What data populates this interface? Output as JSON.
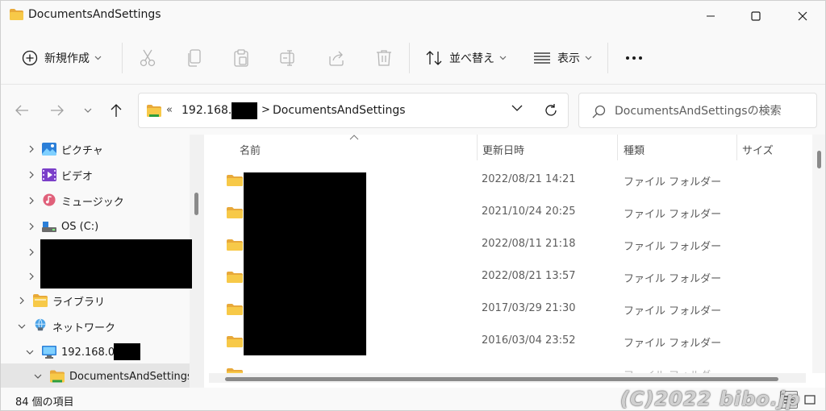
{
  "window": {
    "title": "DocumentsAndSettings",
    "colors": {
      "folder": "#f7c948",
      "folder_dark": "#e8a93a",
      "accent": "#0067c0"
    }
  },
  "commandbar": {
    "new_label": "新規作成",
    "sort_label": "並べ替え",
    "view_label": "表示",
    "more_label": "•••"
  },
  "address": {
    "overflow": "«",
    "ip_prefix": "192.168.0",
    "arrow": ">",
    "current_folder": "DocumentsAndSettings"
  },
  "search": {
    "placeholder": "DocumentsAndSettingsの検索"
  },
  "nav": {
    "items": [
      {
        "label": "ピクチャ",
        "icon": "pictures-icon"
      },
      {
        "label": "ビデオ",
        "icon": "videos-icon"
      },
      {
        "label": "ミュージック",
        "icon": "music-icon"
      },
      {
        "label": "OS (C:)",
        "icon": "drive-icon"
      },
      {
        "label": "ライブラリ",
        "icon": "library-icon"
      },
      {
        "label": "ネットワーク",
        "icon": "network-icon"
      },
      {
        "label": "192.168.0.",
        "icon": "computer-icon"
      },
      {
        "label": "DocumentsAndSettings",
        "icon": "folder-icon"
      }
    ]
  },
  "list": {
    "columns": {
      "name": "名前",
      "date": "更新日時",
      "type": "種類",
      "size": "サイズ"
    },
    "rows": [
      {
        "date": "2022/08/21 14:21",
        "type": "ファイル フォルダー"
      },
      {
        "date": "2021/10/24 20:25",
        "type": "ファイル フォルダー"
      },
      {
        "date": "2022/08/11 21:18",
        "type": "ファイル フォルダー"
      },
      {
        "date": "2022/08/21 13:57",
        "type": "ファイル フォルダー"
      },
      {
        "date": "2017/03/29 21:30",
        "type": "ファイル フォルダー"
      },
      {
        "date": "2016/03/04 23:52",
        "type": "ファイル フォルダー"
      }
    ],
    "partial_row": {
      "type": "ファイル フォルダー"
    }
  },
  "status": {
    "count": "84 個の項目"
  },
  "watermark": "(C)2022 bibo.jp"
}
